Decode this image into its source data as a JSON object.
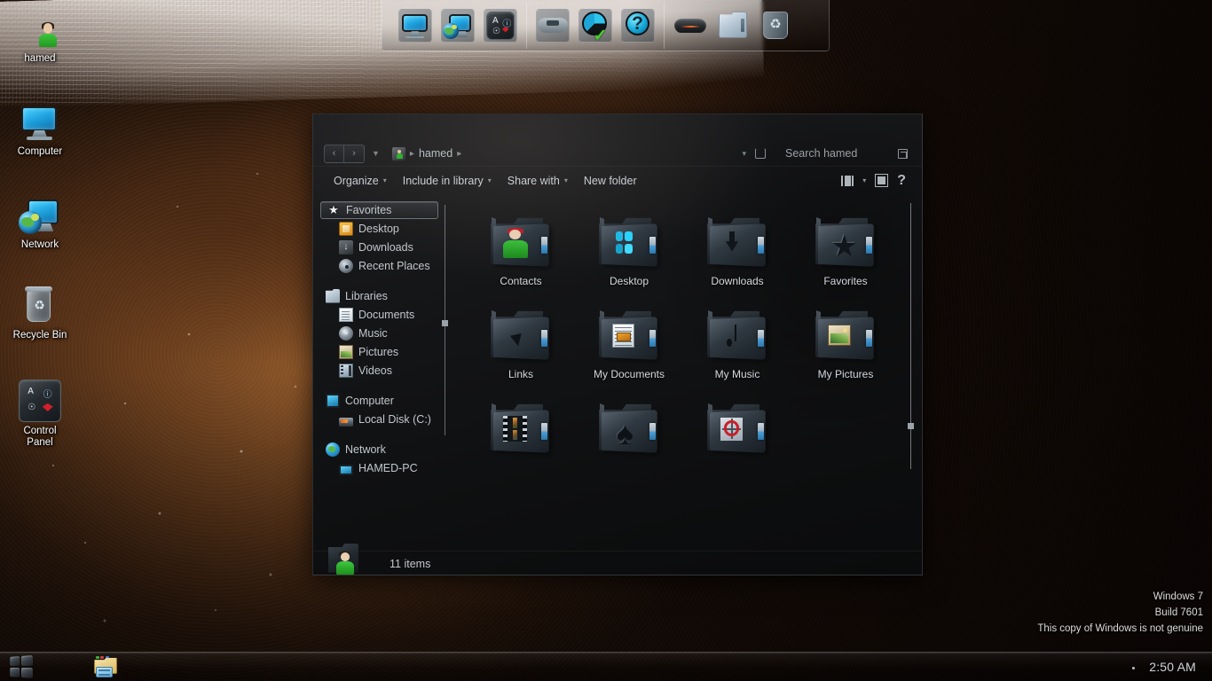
{
  "desktop": {
    "icons": [
      {
        "label": "hamed",
        "icon": "user-folder-icon"
      },
      {
        "label": "Computer",
        "icon": "computer-icon"
      },
      {
        "label": "Network",
        "icon": "network-icon"
      },
      {
        "label": "Recycle Bin",
        "icon": "recycle-bin-icon"
      },
      {
        "label": "Control\nPanel",
        "icon": "control-panel-icon"
      }
    ]
  },
  "dock": {
    "groups": [
      {
        "items": [
          {
            "name": "computer-dock-icon"
          },
          {
            "name": "network-dock-icon"
          },
          {
            "name": "control-panel-dock-icon"
          }
        ]
      },
      {
        "items": [
          {
            "name": "games-dock-icon"
          },
          {
            "name": "disk-defragmenter-dock-icon"
          },
          {
            "name": "help-dock-icon"
          }
        ]
      },
      {
        "items": [
          {
            "name": "mouse-dock-icon"
          },
          {
            "name": "documents-dock-icon"
          },
          {
            "name": "recycle-bin-dock-icon"
          }
        ]
      }
    ]
  },
  "explorer": {
    "address": {
      "back_label": "‹",
      "forward_label": "›",
      "history_caret": "▼",
      "crumb_label": "hamed",
      "crumb_sep": "▸",
      "crumb_sep2": "▸",
      "tail_caret": "▾"
    },
    "search": {
      "placeholder": "Search hamed"
    },
    "toolbar": {
      "organize": "Organize",
      "include_in_library": "Include in library",
      "share_with": "Share with",
      "new_folder": "New folder",
      "caret": "▾",
      "help": "?"
    },
    "navpane": {
      "favorites": {
        "label": "Favorites",
        "items": [
          {
            "label": "Desktop",
            "icon": "desktop-icon"
          },
          {
            "label": "Downloads",
            "icon": "downloads-icon"
          },
          {
            "label": "Recent Places",
            "icon": "recent-places-icon"
          }
        ]
      },
      "libraries": {
        "label": "Libraries",
        "items": [
          {
            "label": "Documents",
            "icon": "documents-icon"
          },
          {
            "label": "Music",
            "icon": "music-icon"
          },
          {
            "label": "Pictures",
            "icon": "pictures-icon"
          },
          {
            "label": "Videos",
            "icon": "videos-icon"
          }
        ]
      },
      "computer": {
        "label": "Computer",
        "items": [
          {
            "label": "Local Disk (C:)",
            "icon": "local-disk-icon"
          }
        ]
      },
      "network": {
        "label": "Network",
        "items": [
          {
            "label": "HAMED-PC",
            "icon": "network-computer-icon"
          }
        ]
      }
    },
    "items": [
      {
        "label": "Contacts",
        "emblem": "person-emblem"
      },
      {
        "label": "Desktop",
        "emblem": "windows-emblem"
      },
      {
        "label": "Downloads",
        "emblem": "down-arrow-emblem"
      },
      {
        "label": "Favorites",
        "emblem": "star-emblem"
      },
      {
        "label": "Links",
        "emblem": "link-arrow-emblem"
      },
      {
        "label": "My Documents",
        "emblem": "documents-emblem"
      },
      {
        "label": "My Music",
        "emblem": "music-note-emblem"
      },
      {
        "label": "My Pictures",
        "emblem": "picture-emblem"
      },
      {
        "label": "",
        "emblem": "film-emblem"
      },
      {
        "label": "",
        "emblem": "spade-emblem"
      },
      {
        "label": "",
        "emblem": "search-target-emblem"
      }
    ],
    "status": {
      "item_count": "11 items"
    }
  },
  "watermark": {
    "line1": "Windows 7",
    "line2": "Build 7601",
    "line3": "This copy of Windows is not genuine"
  },
  "taskbar": {
    "start_label": "start-orb",
    "explorer_label": "windows-explorer-taskbar-button",
    "clock": "2:50 AM"
  },
  "colors": {
    "accent_blue": "#2ad2ff",
    "folder_dark": "#242b31",
    "wallpaper_warm": "#8d5228",
    "watermark_text": "#dcdcdc"
  }
}
